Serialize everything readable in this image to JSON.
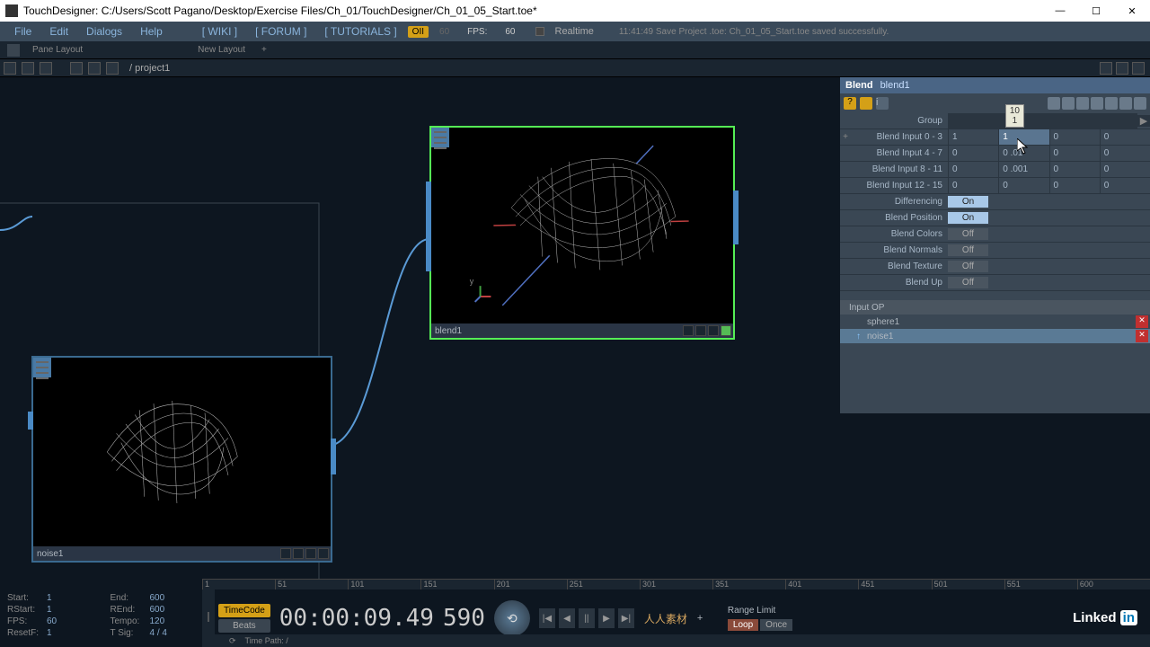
{
  "window": {
    "title": "TouchDesigner: C:/Users/Scott Pagano/Desktop/Exercise Files/Ch_01/TouchDesigner/Ch_01_05_Start.toe*"
  },
  "menubar": {
    "file": "File",
    "edit": "Edit",
    "dialogs": "Dialogs",
    "help": "Help",
    "wiki": "[ WIKI ]",
    "forum": "[ FORUM ]",
    "tutorials": "[ TUTORIALS ]",
    "badge": "OII",
    "fps_label": "FPS:",
    "fps_val": "60",
    "fps_target": "60",
    "realtime": "Realtime",
    "status": "11:41:49 Save Project .toe: Ch_01_05_Start.toe saved successfully."
  },
  "toolbar1": {
    "pane": "Pane Layout",
    "newlayout": "New Layout",
    "plus": "+"
  },
  "path": "/  project1",
  "nodes": {
    "noise": {
      "name": "noise1"
    },
    "blend": {
      "name": "blend1"
    }
  },
  "panel": {
    "optype": "Blend",
    "opname": "blend1",
    "tooltip_label": "10",
    "tooltip_sub": "1",
    "group_label": "Group",
    "rows": [
      {
        "label": "Blend Input 0 - 3",
        "vals": [
          "1",
          "1",
          "0",
          "0"
        ],
        "active": 1
      },
      {
        "label": "Blend Input 4 - 7",
        "vals": [
          "0",
          "0 .01",
          "0",
          "0"
        ]
      },
      {
        "label": "Blend Input 8 - 11",
        "vals": [
          "0",
          "0 .001",
          "0",
          "0"
        ]
      },
      {
        "label": "Blend Input 12 - 15",
        "vals": [
          "0",
          "0",
          "0",
          "0"
        ]
      }
    ],
    "toggles": [
      {
        "label": "Differencing",
        "state": "On"
      },
      {
        "label": "Blend Position",
        "state": "On"
      },
      {
        "label": "Blend Colors",
        "state": "Off"
      },
      {
        "label": "Blend Normals",
        "state": "Off"
      },
      {
        "label": "Blend Texture",
        "state": "Off"
      },
      {
        "label": "Blend Up",
        "state": "Off"
      }
    ],
    "inputop_header": "Input OP",
    "inputs": [
      "sphere1",
      "noise1"
    ]
  },
  "ruler": [
    "1",
    "51",
    "101",
    "151",
    "201",
    "251",
    "301",
    "351",
    "401",
    "451",
    "501",
    "551",
    "600"
  ],
  "stats": [
    [
      {
        "k": "Start:",
        "v": "1"
      },
      {
        "k": "End:",
        "v": "600"
      }
    ],
    [
      {
        "k": "RStart:",
        "v": "1"
      },
      {
        "k": "REnd:",
        "v": "600"
      }
    ],
    [
      {
        "k": "FPS:",
        "v": "60"
      },
      {
        "k": "Tempo:",
        "v": "120"
      }
    ],
    [
      {
        "k": "ResetF:",
        "v": "1"
      },
      {
        "k": "T Sig:",
        "v": "4  /  4"
      }
    ]
  ],
  "transport": {
    "timecode_btn": "TimeCode",
    "beats_btn": "Beats",
    "timecode": "00:00:09.49",
    "frame": "590",
    "range_limit": "Range Limit",
    "loop": "Loop",
    "once": "Once",
    "timepath": "Time Path: /"
  },
  "linkedin": "Linked"
}
